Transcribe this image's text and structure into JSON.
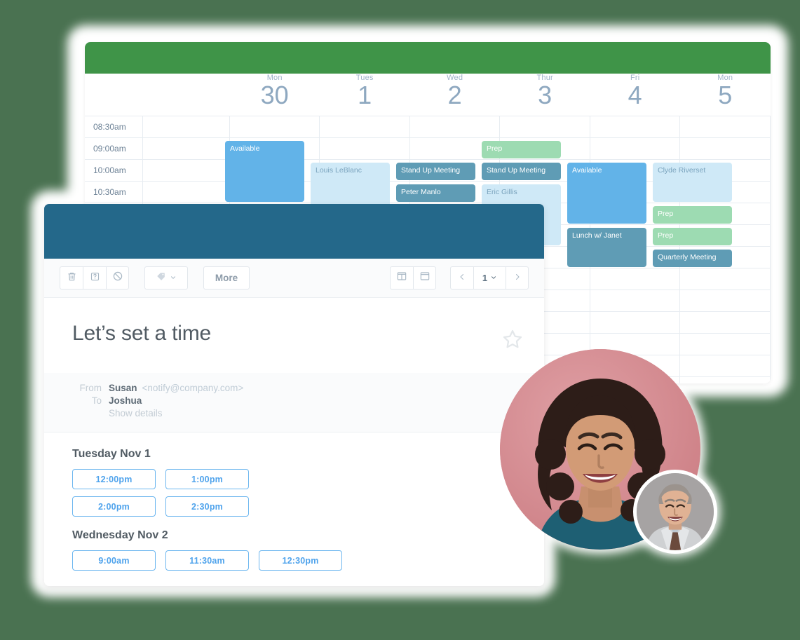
{
  "calendar": {
    "topbar_color": "#3f9448",
    "time_labels": [
      "08:30am",
      "09:00am",
      "10:00am",
      "10:30am"
    ],
    "days": [
      {
        "dow": "Mon",
        "num": "30"
      },
      {
        "dow": "Tues",
        "num": "1"
      },
      {
        "dow": "Wed",
        "num": "2"
      },
      {
        "dow": "Thur",
        "num": "3"
      },
      {
        "dow": "Fri",
        "num": "4"
      },
      {
        "dow": "Mon",
        "num": "5"
      }
    ],
    "events": [
      {
        "label": "Available",
        "color": "blue",
        "col": 0,
        "row": 1,
        "span": 3
      },
      {
        "label": "Louis LeBlanc",
        "color": "lightblue",
        "col": 1,
        "row": 2,
        "span": 3
      },
      {
        "label": "Stand Up Meeting",
        "color": "teal",
        "col": 2,
        "row": 2,
        "span": 1
      },
      {
        "label": "Peter Manlo",
        "color": "teal",
        "col": 2,
        "row": 3,
        "span": 1
      },
      {
        "label": "Prep",
        "color": "green",
        "col": 3,
        "row": 1,
        "span": 1
      },
      {
        "label": "Stand Up Meeting",
        "color": "teal",
        "col": 3,
        "row": 2,
        "span": 1
      },
      {
        "label": "Eric Gillis",
        "color": "lightblue",
        "col": 3,
        "row": 3,
        "span": 3
      },
      {
        "label": "Available",
        "color": "blue",
        "col": 4,
        "row": 2,
        "span": 3
      },
      {
        "label": "Lunch w/ Janet",
        "color": "teal",
        "col": 4,
        "row": 5,
        "span": 2
      },
      {
        "label": "Clyde Riverset",
        "color": "lightblue",
        "col": 5,
        "row": 2,
        "span": 2
      },
      {
        "label": "Prep",
        "color": "green",
        "col": 5,
        "row": 4,
        "span": 1
      },
      {
        "label": "Prep",
        "color": "green",
        "col": 5,
        "row": 5,
        "span": 1
      },
      {
        "label": "Quarterly Meeting",
        "color": "teal",
        "col": 5,
        "row": 6,
        "span": 1
      }
    ],
    "hidden_events": [
      {
        "label": "",
        "color": "lightblue",
        "row": 6,
        "span": 2
      },
      {
        "label": "",
        "color": "lightblue",
        "row": 8,
        "span": 2
      },
      {
        "label": "",
        "color": "green",
        "row": 11,
        "span": 1
      },
      {
        "label": "",
        "color": "green",
        "row": 12,
        "span": 1
      },
      {
        "label": "",
        "color": "teal",
        "row": 13,
        "span": 1
      }
    ]
  },
  "mail": {
    "topbar_color": "#24688a",
    "toolbar": {
      "delete_icon": "trash-icon",
      "spam_icon": "question-box-icon",
      "block_icon": "block-icon",
      "tag_icon": "tag-icon",
      "tag_chevron": "chevron-down-icon",
      "more_label": "More",
      "split_view_icon": "split-pane-icon",
      "full_view_icon": "single-pane-icon",
      "prev_label": "‹",
      "page_value": "1",
      "page_chevron": "chevron-down-icon",
      "next_label": "›"
    },
    "subject": "Let’s set a time",
    "star_icon": "star-outline-icon",
    "meta": {
      "from_label": "From",
      "from_name": "Susan",
      "from_email": "<notify@company.com>",
      "to_label": "To",
      "to_name": "Joshua",
      "show_details": "Show details"
    },
    "accent_color": "#4fa3ec",
    "schedule": [
      {
        "day": "Tuesday Nov 1",
        "rows": [
          [
            "12:00pm",
            "1:00pm"
          ],
          [
            "2:00pm",
            "2:30pm"
          ]
        ]
      },
      {
        "day": "Wednesday Nov 2",
        "rows": [
          [
            "9:00am",
            "11:30am",
            "12:30pm"
          ]
        ]
      }
    ]
  },
  "avatars": {
    "main": {
      "name": "smiling-woman-avatar",
      "bg": "#d58c92"
    },
    "small": {
      "name": "smiling-man-avatar",
      "bg": "#a9a6a6"
    }
  },
  "page": {
    "background": "#4a7251"
  }
}
